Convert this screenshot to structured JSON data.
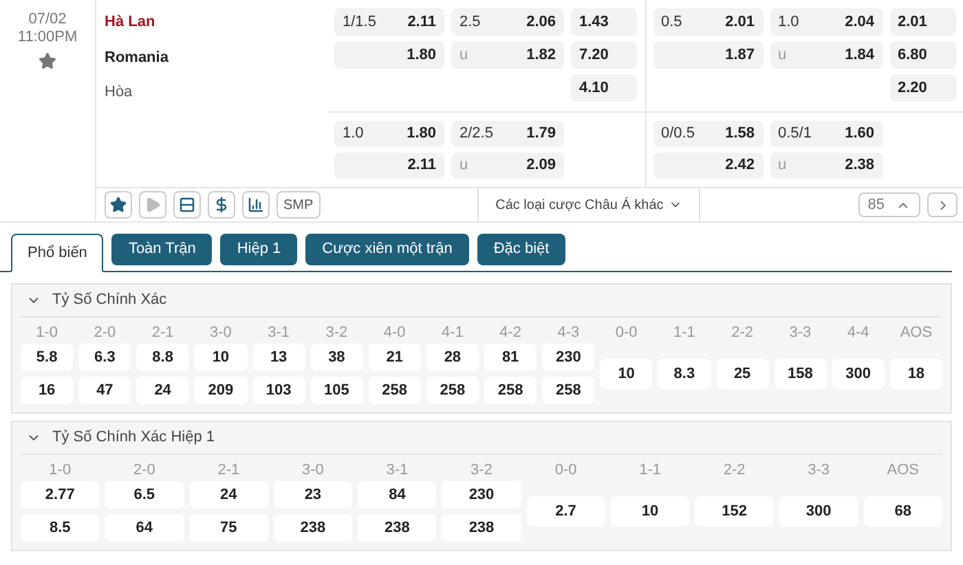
{
  "match": {
    "date": "07/02",
    "time": "11:00PM",
    "home": "Hà Lan",
    "away": "Romania",
    "draw": "Hòa"
  },
  "odds": [
    {
      "lines": [
        {
          "hdp_line": "1/1.5",
          "hdp_home": "2.11",
          "hdp_away": "1.80",
          "ou_line": "2.5",
          "ou_over": "2.06",
          "ou_under_label": "u",
          "ou_under": "1.82",
          "x12": [
            "1.43",
            "7.20",
            "4.10"
          ]
        },
        {
          "hdp_line": "1.0",
          "hdp_home": "1.80",
          "hdp_away": "2.11",
          "ou_line": "2/2.5",
          "ou_over": "1.79",
          "ou_under_label": "u",
          "ou_under": "2.09"
        }
      ]
    },
    {
      "lines": [
        {
          "hdp_line": "0.5",
          "hdp_home": "2.01",
          "hdp_away": "1.87",
          "ou_line": "1.0",
          "ou_over": "2.04",
          "ou_under_label": "u",
          "ou_under": "1.84",
          "x12": [
            "2.01",
            "6.80",
            "2.20"
          ]
        },
        {
          "hdp_line": "0/0.5",
          "hdp_home": "1.58",
          "hdp_away": "2.42",
          "ou_line": "0.5/1",
          "ou_over": "1.60",
          "ou_under_label": "u",
          "ou_under": "2.38"
        }
      ]
    }
  ],
  "tools": [
    {
      "kind": "star",
      "active": true
    },
    {
      "kind": "play",
      "active": false
    },
    {
      "kind": "list",
      "active": true
    },
    {
      "kind": "dollar",
      "active": true
    },
    {
      "kind": "chart",
      "active": true
    },
    {
      "kind": "text",
      "label": "SMP",
      "active": true
    }
  ],
  "other_markets": "Các loại cược Châu Á khác",
  "market_count": "85",
  "tabs": [
    {
      "label": "Phổ biến",
      "selected": true
    },
    {
      "label": "Toàn Trận",
      "selected": false
    },
    {
      "label": "Hiệp 1",
      "selected": false
    },
    {
      "label": "Cược xiên một trận",
      "selected": false
    },
    {
      "label": "Đặc biệt",
      "selected": false
    }
  ],
  "sections": [
    {
      "title": "Tỷ Số Chính Xác",
      "expanded": true,
      "columns": [
        {
          "kind": "pair",
          "label": "1-0",
          "values": [
            "5.8",
            "16"
          ]
        },
        {
          "kind": "pair",
          "label": "2-0",
          "values": [
            "6.3",
            "47"
          ]
        },
        {
          "kind": "pair",
          "label": "2-1",
          "values": [
            "8.8",
            "24"
          ]
        },
        {
          "kind": "pair",
          "label": "3-0",
          "values": [
            "10",
            "209"
          ]
        },
        {
          "kind": "pair",
          "label": "3-1",
          "values": [
            "13",
            "103"
          ]
        },
        {
          "kind": "pair",
          "label": "3-2",
          "values": [
            "38",
            "105"
          ]
        },
        {
          "kind": "pair",
          "label": "4-0",
          "values": [
            "21",
            "258"
          ]
        },
        {
          "kind": "pair",
          "label": "4-1",
          "values": [
            "28",
            "258"
          ]
        },
        {
          "kind": "pair",
          "label": "4-2",
          "values": [
            "81",
            "258"
          ]
        },
        {
          "kind": "pair",
          "label": "4-3",
          "values": [
            "230",
            "258"
          ]
        },
        {
          "kind": "single",
          "label": "0-0",
          "values": [
            "10"
          ]
        },
        {
          "kind": "single",
          "label": "1-1",
          "values": [
            "8.3"
          ]
        },
        {
          "kind": "single",
          "label": "2-2",
          "values": [
            "25"
          ]
        },
        {
          "kind": "single",
          "label": "3-3",
          "values": [
            "158"
          ]
        },
        {
          "kind": "single",
          "label": "4-4",
          "values": [
            "300"
          ]
        },
        {
          "kind": "single",
          "label": "AOS",
          "values": [
            "18"
          ]
        }
      ]
    },
    {
      "title": "Tỷ Số Chính Xác Hiệp 1",
      "expanded": true,
      "columns": [
        {
          "kind": "pair",
          "label": "1-0",
          "values": [
            "2.77",
            "8.5"
          ]
        },
        {
          "kind": "pair",
          "label": "2-0",
          "values": [
            "6.5",
            "64"
          ]
        },
        {
          "kind": "pair",
          "label": "2-1",
          "values": [
            "24",
            "75"
          ]
        },
        {
          "kind": "pair",
          "label": "3-0",
          "values": [
            "23",
            "238"
          ]
        },
        {
          "kind": "pair",
          "label": "3-1",
          "values": [
            "84",
            "238"
          ]
        },
        {
          "kind": "pair",
          "label": "3-2",
          "values": [
            "230",
            "238"
          ]
        },
        {
          "kind": "single",
          "label": "0-0",
          "values": [
            "2.7"
          ]
        },
        {
          "kind": "single",
          "label": "1-1",
          "values": [
            "10"
          ]
        },
        {
          "kind": "single",
          "label": "2-2",
          "values": [
            "152"
          ]
        },
        {
          "kind": "single",
          "label": "3-3",
          "values": [
            "300"
          ]
        },
        {
          "kind": "single",
          "label": "AOS",
          "values": [
            "68"
          ]
        }
      ]
    }
  ]
}
